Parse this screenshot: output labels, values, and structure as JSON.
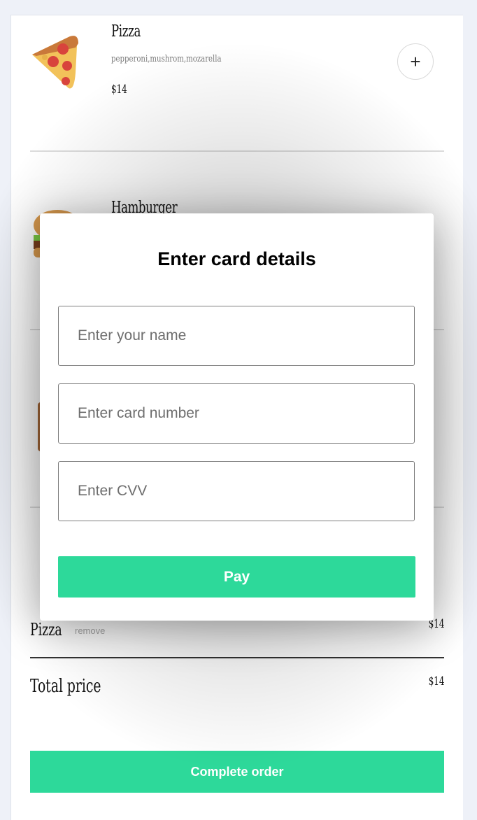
{
  "menu": [
    {
      "name": "Pizza",
      "ingredients": "pepperoni,mushrom,mozarella",
      "price": "$14",
      "icon": "pizza-icon"
    },
    {
      "name": "Hamburger",
      "ingredients": "",
      "price": "",
      "icon": "hamburger-icon"
    },
    {
      "name": "",
      "ingredients": "",
      "price": "",
      "icon": ""
    }
  ],
  "add_label": "+",
  "cart": {
    "items": [
      {
        "name": "Pizza",
        "remove_label": "remove",
        "price": "$14"
      }
    ],
    "total_label": "Total price",
    "total_price": "$14"
  },
  "complete_button": "Complete order",
  "modal": {
    "title": "Enter card details",
    "name_placeholder": "Enter your name",
    "card_placeholder": "Enter card number",
    "cvv_placeholder": "Enter CVV",
    "pay_label": "Pay"
  },
  "colors": {
    "accent": "#2dd99a",
    "background": "#eef1f8"
  }
}
